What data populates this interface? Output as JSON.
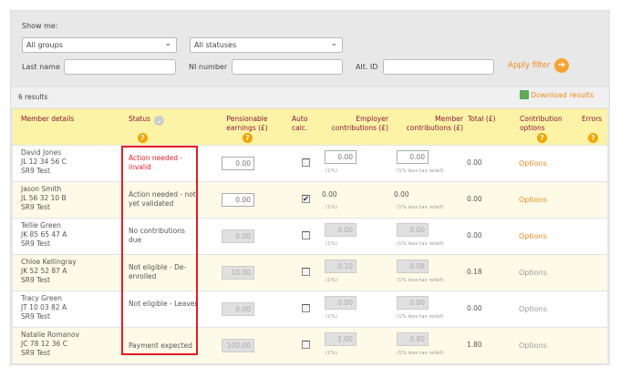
{
  "filter": {
    "show_me": "Show me:",
    "group_select": "All groups",
    "status_select": "All statuses",
    "last_name_label": "Last name",
    "last_name_value": "",
    "ni_label": "NI number",
    "ni_value": "",
    "alt_id_label": "Alt. ID",
    "alt_id_value": "",
    "apply": "Apply filter"
  },
  "results": {
    "count": "6 results",
    "download": "Download results"
  },
  "headers": {
    "member": "Member details",
    "status": "Status",
    "pensionable": "Pensionable earnings (£)",
    "auto": "Auto calc.",
    "employer": "Employer contributions (£)",
    "member_contrib": "Member contributions (£)",
    "total": "Total (£)",
    "options": "Contribution options",
    "errors": "Errors"
  },
  "notes": {
    "employer": "(1%)",
    "member": "(1% less tax relief)"
  },
  "accent": "#f08a1c",
  "alert_color": "#e8202a",
  "rows": [
    {
      "name": "David Jones",
      "ni": "JL 12 34 56 C",
      "group": "SR9 Test",
      "status": "Action needed - invalid",
      "pensionable": "0.00",
      "auto": false,
      "employer": "0.00",
      "member": "0.00",
      "total": "0.00",
      "options": "Options",
      "editable": true,
      "alert": true
    },
    {
      "name": "Jason Smith",
      "ni": "JL 56 32 10 B",
      "group": "SR9 Test",
      "status": "Action needed - not yet validated",
      "pensionable": "0.00",
      "auto": true,
      "employer": "0.00",
      "member": "0.00",
      "total": "0.00",
      "options": "Options",
      "editable": "partial",
      "alert": false
    },
    {
      "name": "Tellie Green",
      "ni": "JK 85 65 47 A",
      "group": "SR9 Test",
      "status": "No contributions due",
      "pensionable": "0.00",
      "auto": false,
      "employer": "0.00",
      "member": "0.00",
      "total": "0.00",
      "options": "Options",
      "editable": false,
      "alert": false
    },
    {
      "name": "Chloe Kellingray",
      "ni": "JK 52 52 87 A",
      "group": "SR9 Test",
      "status": "Not eligible - De-enrolled",
      "pensionable": "10.00",
      "auto": false,
      "employer": "0.10",
      "member": "0.08",
      "total": "0.18",
      "options": "Options",
      "editable": false,
      "alert": false
    },
    {
      "name": "Tracy Green",
      "ni": "JT 10 03 82 A",
      "group": "SR9 Test",
      "status": "Not eligible - Leaver",
      "pensionable": "0.00",
      "auto": false,
      "employer": "0.00",
      "member": "0.00",
      "total": "0.00",
      "options": "Options",
      "editable": false,
      "alert": false
    },
    {
      "name": "Natalie Romanov",
      "ni": "JC 78 12 36 C",
      "group": "SR9 Test",
      "status": "Payment expected",
      "pensionable": "100.00",
      "auto": false,
      "employer": "1.00",
      "member": "0.80",
      "total": "1.80",
      "options": "Options",
      "editable": false,
      "alert": false
    }
  ]
}
